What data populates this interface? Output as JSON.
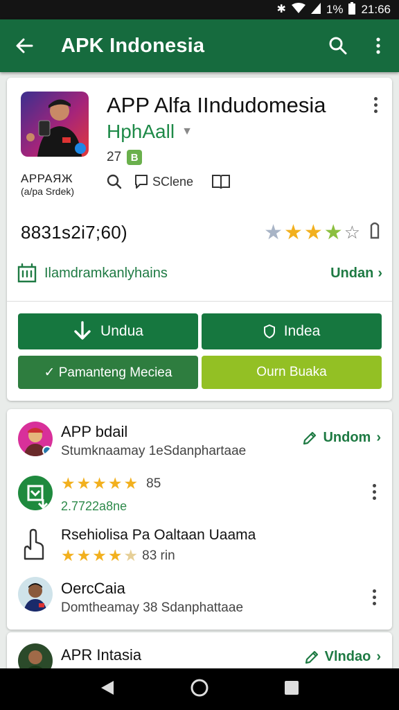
{
  "status_bar": {
    "battery": "1%",
    "time": "21:66"
  },
  "app_bar": {
    "title": "APK Indonesia"
  },
  "app": {
    "title": "APP Alfa IIndudomesia",
    "developer": "HphAall",
    "meta_count": "27",
    "age_badge": "B",
    "tagline_line1": "APPAЯЖ",
    "tagline_line2": "(a/pa Srdek)",
    "tool_share_label": "SClene",
    "rating_count": "8831s2i7;60)",
    "feature_label": "Ilamdramkanlyhains",
    "feature_link": "Undan",
    "buttons": {
      "install": "Undua",
      "open": "Indea",
      "wishlist": "✓ Pamanteng Meciea",
      "share": "Ourn Buaka"
    }
  },
  "reviews": [
    {
      "name": "APP bdail",
      "subtitle": "Stumknaamay 1eSdanphartaae",
      "action": "Undom"
    },
    {
      "rating_value": "85",
      "count": "2.7722a8ne",
      "stars": 5
    },
    {
      "name": "Rsehiolisa Pa Oaltaan Uaama",
      "rating_value": "83 rin",
      "stars": 4
    },
    {
      "name": "OercCaia",
      "subtitle": "Domtheamay 38 Sdanphattaae"
    }
  ],
  "partial_review": {
    "name": "APR Intasia",
    "action": "Vlndao"
  },
  "colors": {
    "primary": "#166b3e",
    "accent_green": "#1e7a43",
    "lime": "#93c024",
    "star": "#f2b01e"
  }
}
